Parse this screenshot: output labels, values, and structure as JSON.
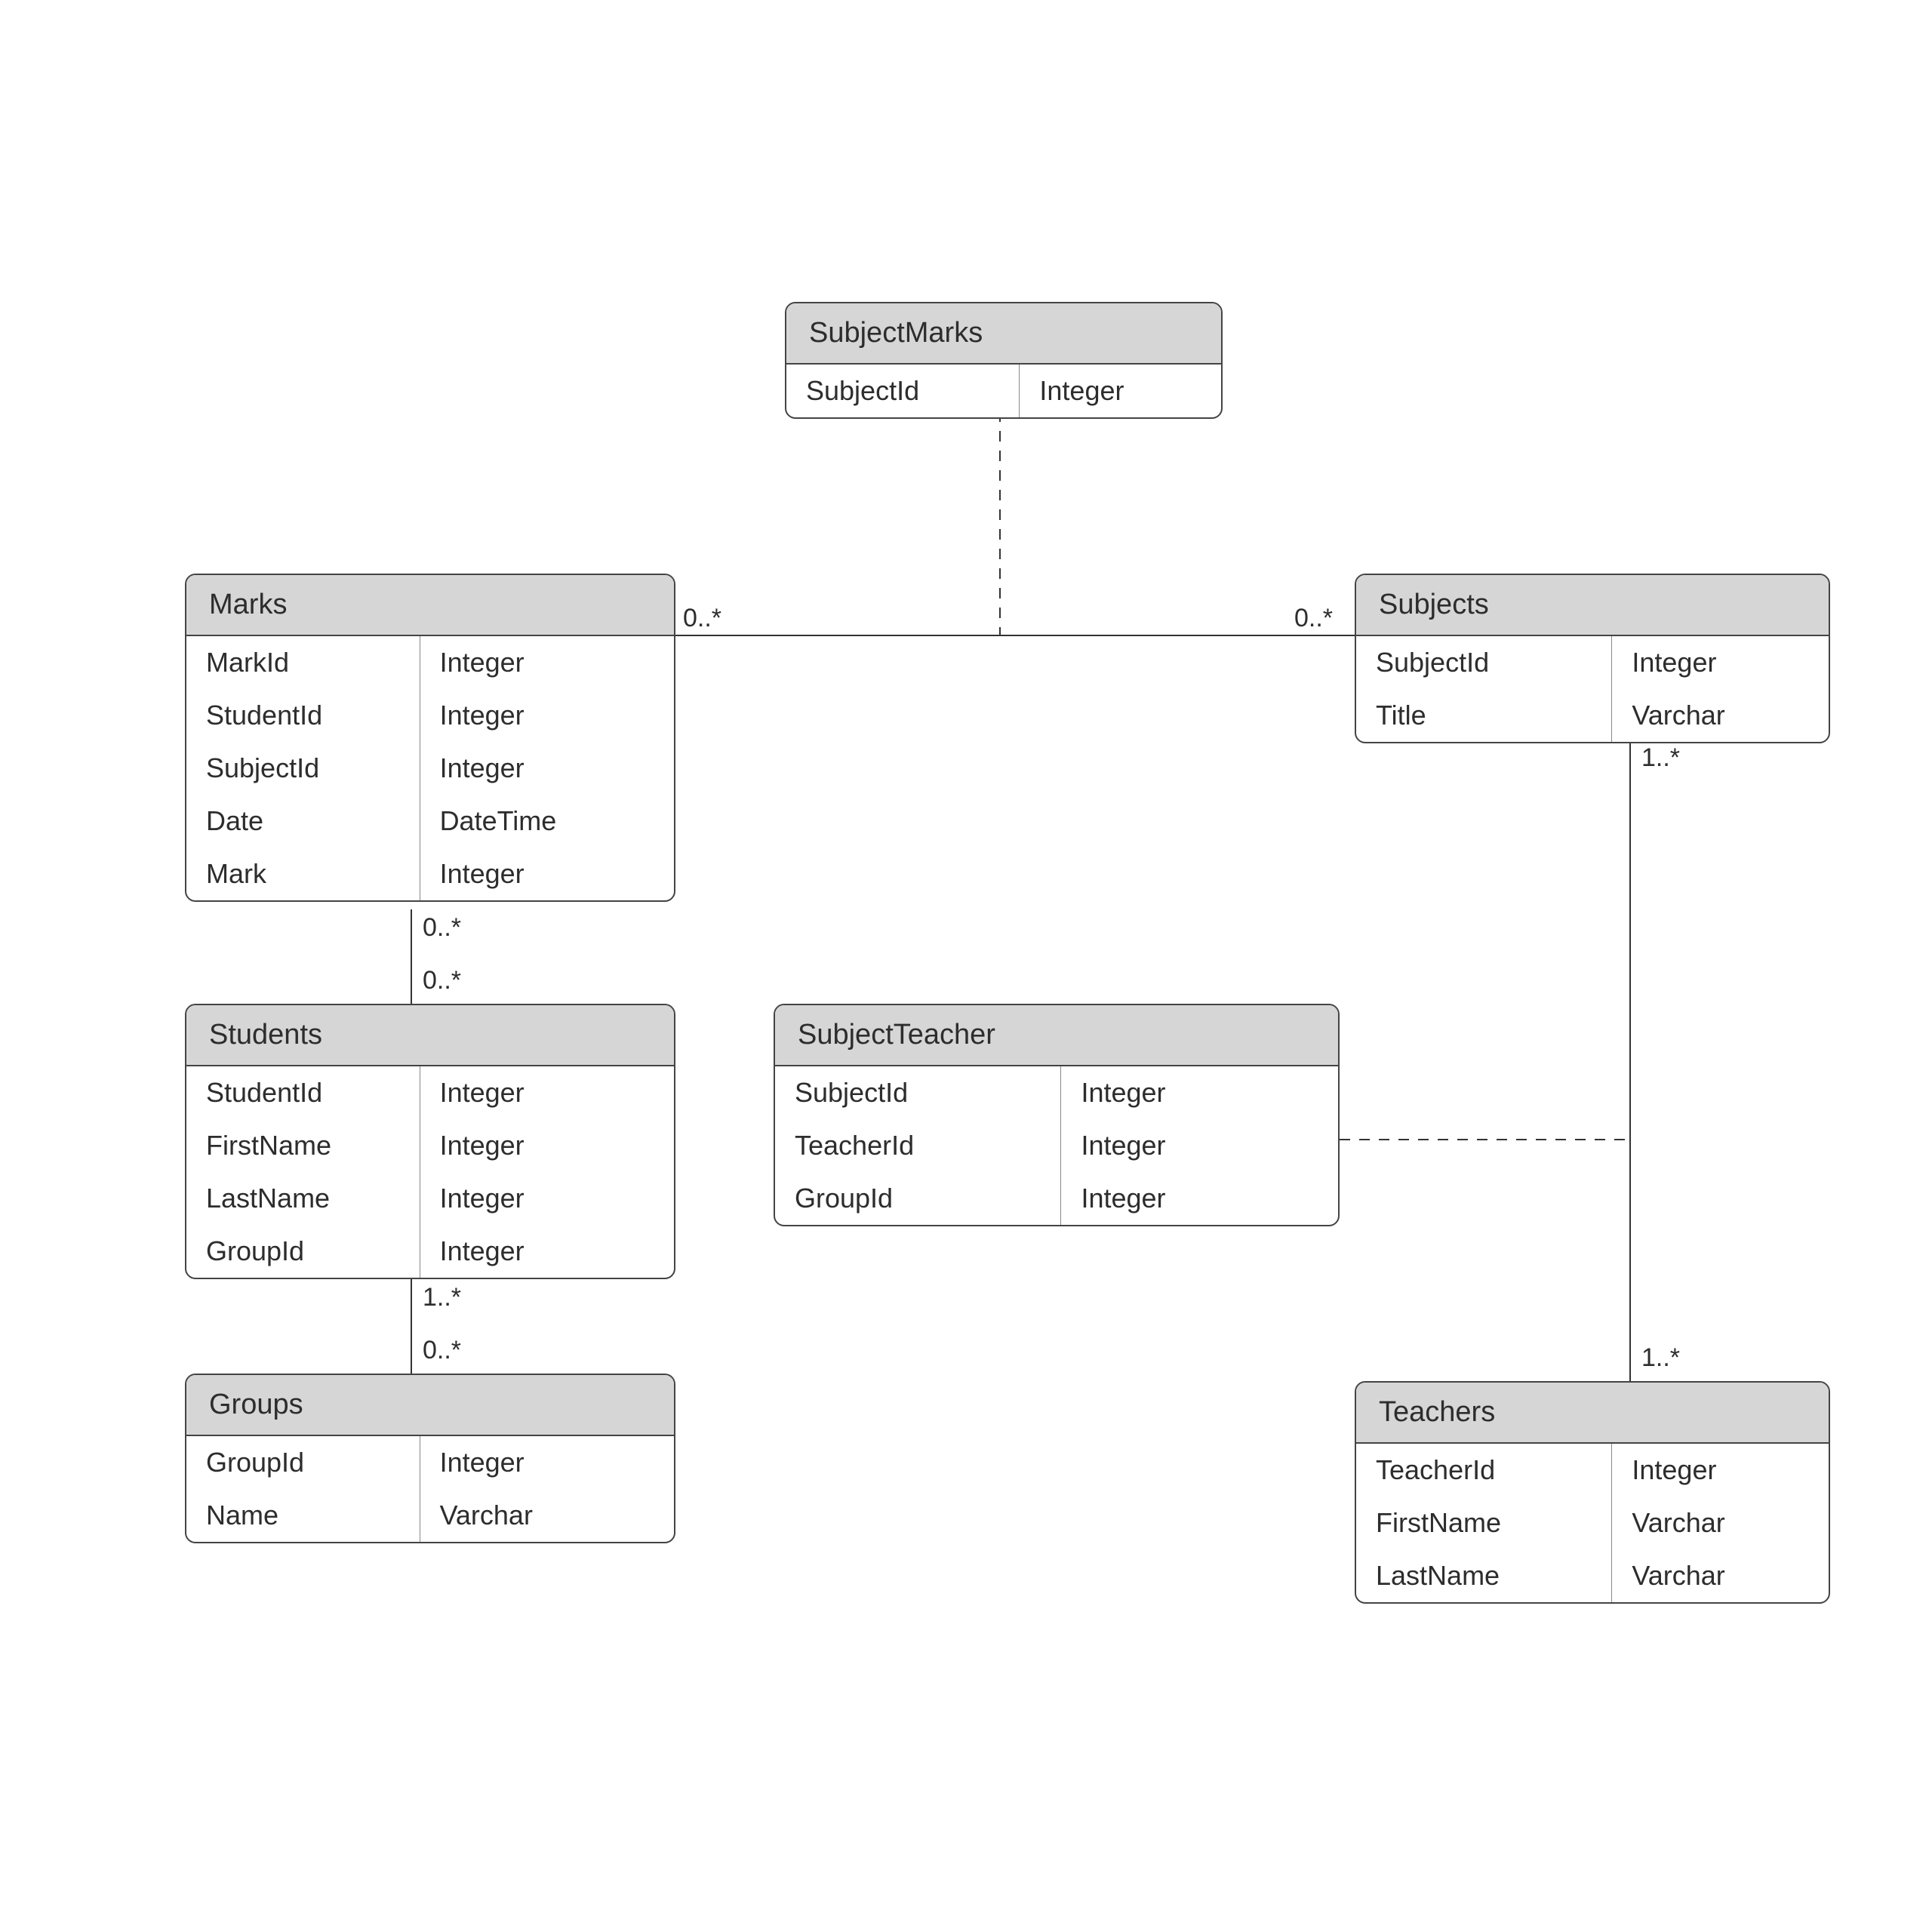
{
  "entities": {
    "subjectMarks": {
      "title": "SubjectMarks",
      "attrs": [
        {
          "name": "SubjectId",
          "type": "Integer"
        }
      ]
    },
    "marks": {
      "title": "Marks",
      "attrs": [
        {
          "name": "MarkId",
          "type": "Integer"
        },
        {
          "name": "StudentId",
          "type": "Integer"
        },
        {
          "name": "SubjectId",
          "type": "Integer"
        },
        {
          "name": "Date",
          "type": "DateTime"
        },
        {
          "name": "Mark",
          "type": "Integer"
        }
      ]
    },
    "subjects": {
      "title": "Subjects",
      "attrs": [
        {
          "name": "SubjectId",
          "type": "Integer"
        },
        {
          "name": "Title",
          "type": "Varchar"
        }
      ]
    },
    "students": {
      "title": "Students",
      "attrs": [
        {
          "name": "StudentId",
          "type": "Integer"
        },
        {
          "name": "FirstName",
          "type": "Integer"
        },
        {
          "name": "LastName",
          "type": "Integer"
        },
        {
          "name": "GroupId",
          "type": "Integer"
        }
      ]
    },
    "subjectTeacher": {
      "title": "SubjectTeacher",
      "attrs": [
        {
          "name": "SubjectId",
          "type": "Integer"
        },
        {
          "name": "TeacherId",
          "type": "Integer"
        },
        {
          "name": "GroupId",
          "type": "Integer"
        }
      ]
    },
    "groups": {
      "title": "Groups",
      "attrs": [
        {
          "name": "GroupId",
          "type": "Integer"
        },
        {
          "name": "Name",
          "type": "Varchar"
        }
      ]
    },
    "teachers": {
      "title": "Teachers",
      "attrs": [
        {
          "name": "TeacherId",
          "type": "Integer"
        },
        {
          "name": "FirstName",
          "type": "Varchar"
        },
        {
          "name": "LastName",
          "type": "Varchar"
        }
      ]
    }
  },
  "multiplicities": {
    "marksSubjects_left": "0..*",
    "marksSubjects_right": "0..*",
    "marksStudents_top": "0..*",
    "marksStudents_bottom": "0..*",
    "studentsGroups_top": "1..*",
    "studentsGroups_bottom": "0..*",
    "subjectsTeachers_top": "1..*",
    "subjectsTeachers_bottom": "1..*"
  }
}
